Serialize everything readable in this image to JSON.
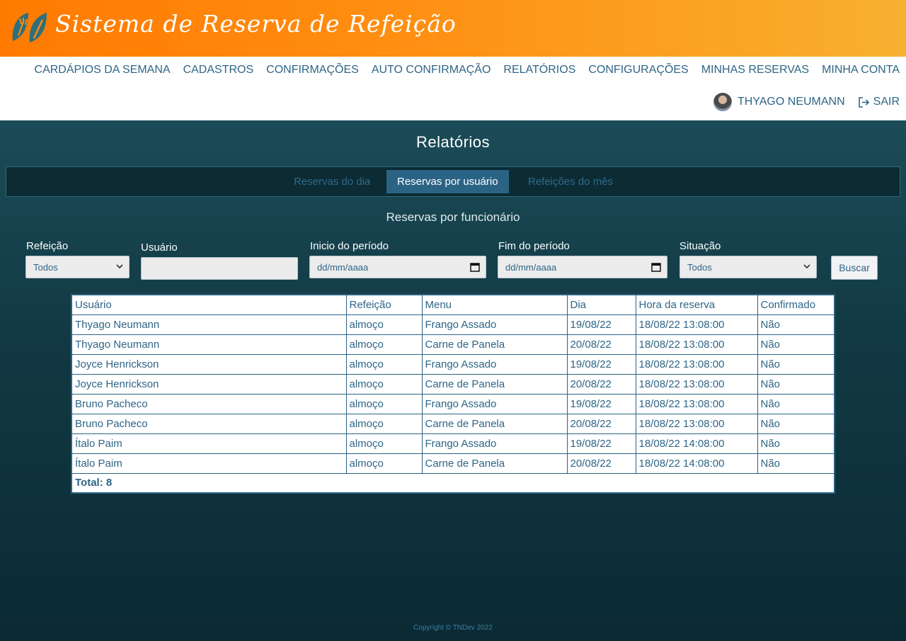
{
  "header": {
    "title": "Sistema de Reserva de Refeição",
    "logo_icon": "leaf-fork-icon",
    "colors": {
      "gradient_start": "#ff7a00",
      "gradient_end": "#f8b030"
    }
  },
  "nav": {
    "items": [
      {
        "label": "CARDÁPIOS DA SEMANA"
      },
      {
        "label": "CADASTROS"
      },
      {
        "label": "CONFIRMAÇÕES"
      },
      {
        "label": "AUTO CONFIRMAÇÃO"
      },
      {
        "label": "RELATÓRIOS"
      },
      {
        "label": "CONFIGURAÇÕES"
      },
      {
        "label": "MINHAS RESERVAS"
      },
      {
        "label": "MINHA CONTA"
      }
    ],
    "user_name": "THYAGO NEUMANN",
    "logout_label": "SAIR",
    "logout_icon": "logout-icon"
  },
  "main": {
    "title": "Relatórios",
    "tabs": [
      {
        "label": "Reservas do dia",
        "active": false
      },
      {
        "label": "Reservas por usuário",
        "active": true
      },
      {
        "label": "Refeições do mês",
        "active": false
      }
    ],
    "subtitle": "Reservas por funcionário",
    "filters": {
      "refeicao_label": "Refeição",
      "refeicao_value": "Todos",
      "usuario_label": "Usuário",
      "usuario_value": "",
      "inicio_label": "Inicio do período",
      "inicio_placeholder": "dd/mm/aaaa",
      "fim_label": "Fim do período",
      "fim_placeholder": "dd/mm/aaaa",
      "situacao_label": "Situação",
      "situacao_value": "Todos",
      "buscar_label": "Buscar"
    },
    "table": {
      "headers": [
        "Usuário",
        "Refeição",
        "Menu",
        "Dia",
        "Hora da reserva",
        "Confirmado"
      ],
      "rows": [
        [
          "Thyago Neumann",
          "almoço",
          "Frango Assado",
          "19/08/22",
          "18/08/22 13:08:00",
          "Não"
        ],
        [
          "Thyago Neumann",
          "almoço",
          "Carne de Panela",
          "20/08/22",
          "18/08/22 13:08:00",
          "Não"
        ],
        [
          "Joyce Henrickson",
          "almoço",
          "Frango Assado",
          "19/08/22",
          "18/08/22 13:08:00",
          "Não"
        ],
        [
          "Joyce Henrickson",
          "almoço",
          "Carne de Panela",
          "20/08/22",
          "18/08/22 13:08:00",
          "Não"
        ],
        [
          "Bruno Pacheco",
          "almoço",
          "Frango Assado",
          "19/08/22",
          "18/08/22 13:08:00",
          "Não"
        ],
        [
          "Bruno Pacheco",
          "almoço",
          "Carne de Panela",
          "20/08/22",
          "18/08/22 13:08:00",
          "Não"
        ],
        [
          "Ítalo Paim",
          "almoço",
          "Frango Assado",
          "19/08/22",
          "18/08/22 14:08:00",
          "Não"
        ],
        [
          "Ítalo Paim",
          "almoço",
          "Carne de Panela",
          "20/08/22",
          "18/08/22 14:08:00",
          "Não"
        ]
      ],
      "total": "Total: 8"
    }
  },
  "footer": {
    "text": "Copyright © TNDev 2022"
  }
}
